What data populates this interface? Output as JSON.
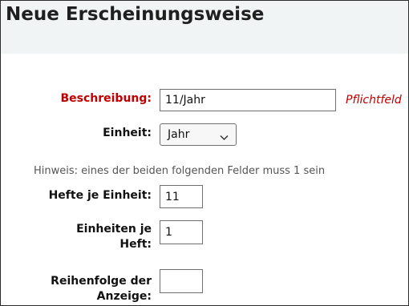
{
  "page": {
    "title": "Neue Erscheinungsweise"
  },
  "form": {
    "beschreibung": {
      "label": "Beschreibung:",
      "value": "11/Jahr",
      "required_note": "Pflichtfeld"
    },
    "einheit": {
      "label": "Einheit:",
      "selected": "Jahr"
    },
    "hint": "Hinweis: eines der beiden folgenden Felder muss 1 sein",
    "hefte_je_einheit": {
      "label": "Hefte je Einheit:",
      "value": "11"
    },
    "einheiten_je_heft": {
      "label": "Einheiten je Heft:",
      "value": "1"
    },
    "reihenfolge": {
      "label": "Reihenfolge der Anzeige:",
      "value": ""
    }
  },
  "colors": {
    "header_bg": "#f1f4f5",
    "required_red": "#c00000"
  },
  "icons": {
    "select_arrow": "chevron-down-icon"
  }
}
